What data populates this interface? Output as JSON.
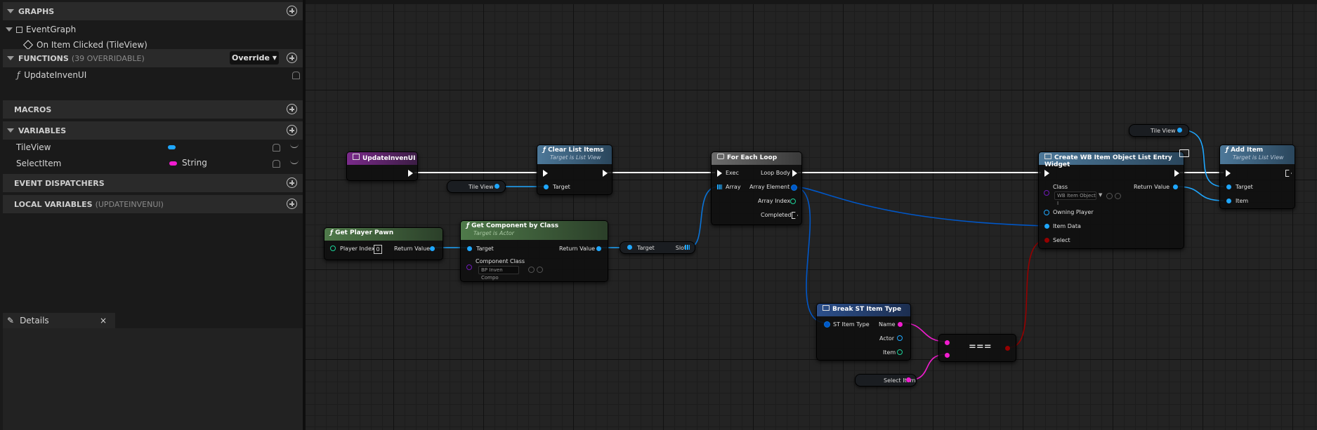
{
  "left_panel": {
    "graphs": {
      "title": "GRAPHS",
      "tree_root": "EventGraph",
      "tree_child": "On Item Clicked (TileView)"
    },
    "functions": {
      "title": "FUNCTIONS",
      "subtitle": "(39 OVERRIDABLE)",
      "override_label": "Override",
      "items": [
        "UpdateInvenUI"
      ]
    },
    "macros": {
      "title": "MACROS"
    },
    "variables": {
      "title": "VARIABLES",
      "items": [
        {
          "name": "TileView",
          "type": "",
          "color": "#1fa7ff"
        },
        {
          "name": "SelectItem",
          "type": "String",
          "color": "#f21cd0"
        }
      ]
    },
    "event_dispatchers": {
      "title": "EVENT DISPATCHERS"
    },
    "local_variables": {
      "title": "LOCAL VARIABLES",
      "subtitle": "(UPDATEINVENUI)"
    },
    "details_tab": {
      "label": "Details",
      "close": "×"
    }
  },
  "graph": {
    "nodes": {
      "update_inven_ui": {
        "title": "UpdateInvenUI"
      },
      "clear_list_items": {
        "title": "Clear List Items",
        "subtitle": "Target is List View",
        "pin_target": "Target"
      },
      "for_each_loop": {
        "title": "For Each Loop",
        "pin_exec": "Exec",
        "pin_array": "Array",
        "pin_loop_body": "Loop Body",
        "pin_array_element": "Array Element",
        "pin_array_index": "Array Index",
        "pin_completed": "Completed"
      },
      "create_widget": {
        "title": "Create WB Item Object List Entry Widget",
        "pin_class": "Class",
        "class_value": "WB Item Object I",
        "pin_return": "Return Value",
        "pin_owning_player": "Owning Player",
        "pin_item_data": "Item Data",
        "pin_select": "Select"
      },
      "add_item": {
        "title": "Add Item",
        "subtitle": "Target is List View",
        "pin_target": "Target",
        "pin_item": "Item"
      },
      "get_player_pawn": {
        "title": "Get Player Pawn",
        "pin_player_index": "Player Index",
        "player_index_value": "0",
        "pin_return": "Return Value"
      },
      "get_component_by_class": {
        "title": "Get Component by Class",
        "subtitle": "Target is Actor",
        "pin_target": "Target",
        "pin_return": "Return Value",
        "pin_component_class": "Component Class",
        "component_class_value": "BP Inven Compo"
      },
      "break_st_item_type": {
        "title": "Break ST Item Type",
        "pin_input": "ST Item Type",
        "pin_name": "Name",
        "pin_actor": "Actor",
        "pin_item": "Item"
      },
      "equal": {
        "title": "==="
      }
    },
    "reroutes": {
      "tile_view_1": "Tile View",
      "tile_view_2": "Tile View",
      "cast_target": "Target",
      "cast_slot": "Slot",
      "select_item": "Select Item"
    }
  },
  "colors": {
    "exec": "#ffffff",
    "object": "#1fa7ff",
    "string": "#f21cd0",
    "bool": "#950000",
    "struct": "#0057c8",
    "func_header": "#3b6a8b",
    "event_header": "#5e2c6a",
    "pure_header": "#3e6e3a"
  }
}
